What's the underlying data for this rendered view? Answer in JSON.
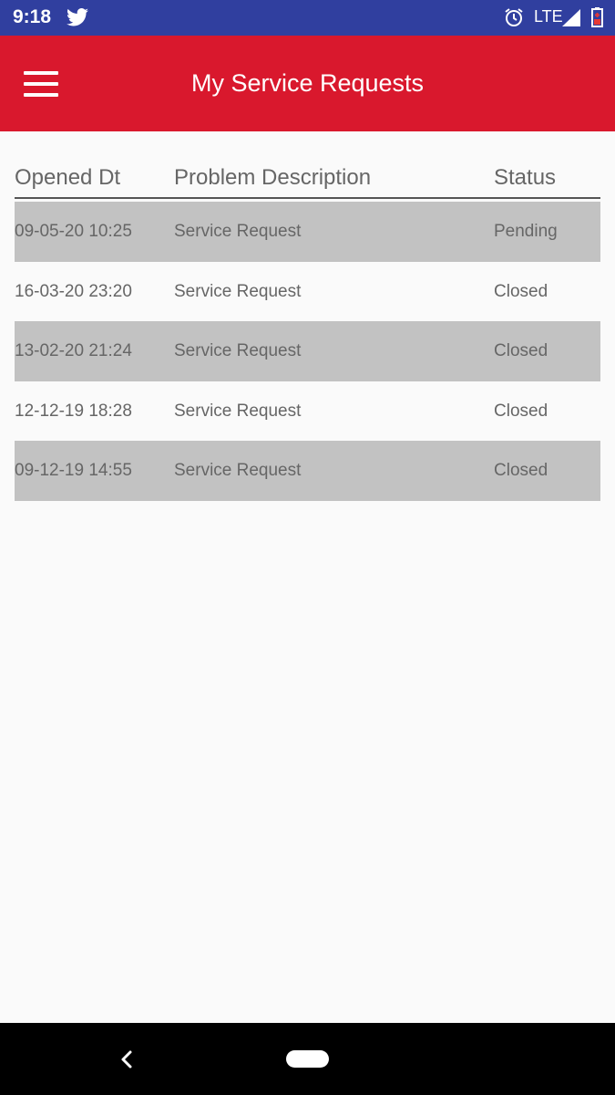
{
  "status_bar": {
    "time": "9:18",
    "network": "LTE",
    "icons": [
      "twitter-icon",
      "alarm-icon",
      "signal-icon",
      "battery-icon"
    ],
    "color": "#303f9f"
  },
  "app_bar": {
    "title": "My Service Requests",
    "color": "#d9182d",
    "menu_icon": "hamburger-menu-icon"
  },
  "table": {
    "headers": [
      "Opened Dt",
      "Problem Description",
      "Status"
    ],
    "rows": [
      {
        "opened": "09-05-20 10:25",
        "description": "Service Request",
        "status": "Pending"
      },
      {
        "opened": "16-03-20 23:20",
        "description": "Service Request",
        "status": "Closed"
      },
      {
        "opened": "13-02-20 21:24",
        "description": "Service Request",
        "status": "Closed"
      },
      {
        "opened": "12-12-19 18:28",
        "description": "Service Request",
        "status": "Closed"
      },
      {
        "opened": "09-12-19 14:55",
        "description": "Service Request",
        "status": "Closed"
      }
    ],
    "shaded_row_color": "#c2c2c2"
  },
  "nav_bar": {
    "icons": [
      "back-icon",
      "home-pill-icon"
    ]
  }
}
